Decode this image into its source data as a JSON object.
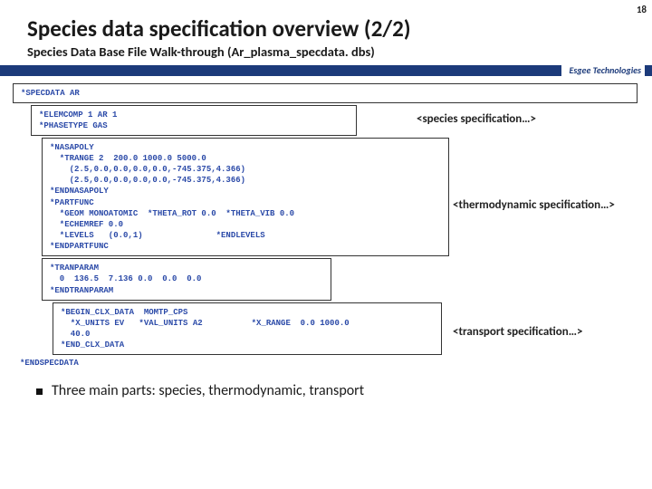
{
  "page_number": "18",
  "title": "Species data specification overview (2/2)",
  "subtitle": "Species Data Base File Walk-through (Ar_plasma_specdata. dbs)",
  "esgee": "Esgee Technologies",
  "code": {
    "top": "*SPECDATA AR",
    "elem": "*ELEMCOMP 1 AR 1\n*PHASETYPE GAS",
    "nasa": "*NASAPOLY\n  *TRANGE 2  200.0 1000.0 5000.0\n    (2.5,0.0,0.0,0.0,0.0,-745.375,4.366)\n    (2.5,0.0,0.0,0.0,0.0,-745.375,4.366)\n*ENDNASAPOLY\n*PARTFUNC\n  *GEOM MONOATOMIC  *THETA_ROT 0.0  *THETA_VIB 0.0\n  *ECHEMREF 0.0\n  *LEVELS   (0.0,1)               *ENDLEVELS\n*ENDPARTFUNC",
    "tran": "*TRANPARAM\n  0  136.5  7.136 0.0  0.0  0.0\n*ENDTRANPARAM",
    "clx": "*BEGIN_CLX_DATA  MOMTP_CPS\n  *X_UNITS EV   *VAL_UNITS A2          *X_RANGE  0.0 1000.0\n  40.0\n*END_CLX_DATA",
    "end": "*ENDSPECDATA"
  },
  "annot": {
    "species": "<species specification…>",
    "thermo": "<thermodynamic specification…>",
    "transport": "<transport specification…>"
  },
  "bullet": "Three main parts: species, thermodynamic, transport"
}
